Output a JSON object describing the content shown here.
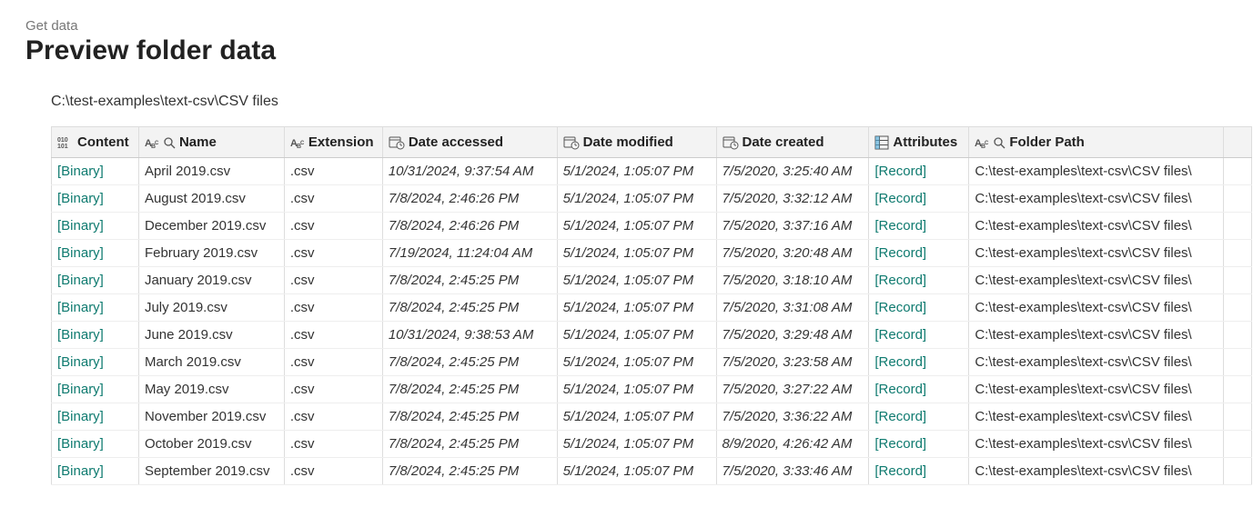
{
  "breadcrumb": "Get data",
  "title": "Preview folder data",
  "folderPath": "C:\\test-examples\\text-csv\\CSV files",
  "columns": {
    "content": "Content",
    "name": "Name",
    "extension": "Extension",
    "accessed": "Date accessed",
    "modified": "Date modified",
    "created": "Date created",
    "attributes": "Attributes",
    "folderPath": "Folder Path"
  },
  "labels": {
    "binary": "[Binary]",
    "record": "[Record]"
  },
  "rows": [
    {
      "name": "April 2019.csv",
      "ext": ".csv",
      "accessed": "10/31/2024, 9:37:54 AM",
      "modified": "5/1/2024, 1:05:07 PM",
      "created": "7/5/2020, 3:25:40 AM",
      "path": "C:\\test-examples\\text-csv\\CSV files\\"
    },
    {
      "name": "August 2019.csv",
      "ext": ".csv",
      "accessed": "7/8/2024, 2:46:26 PM",
      "modified": "5/1/2024, 1:05:07 PM",
      "created": "7/5/2020, 3:32:12 AM",
      "path": "C:\\test-examples\\text-csv\\CSV files\\"
    },
    {
      "name": "December 2019.csv",
      "ext": ".csv",
      "accessed": "7/8/2024, 2:46:26 PM",
      "modified": "5/1/2024, 1:05:07 PM",
      "created": "7/5/2020, 3:37:16 AM",
      "path": "C:\\test-examples\\text-csv\\CSV files\\"
    },
    {
      "name": "February 2019.csv",
      "ext": ".csv",
      "accessed": "7/19/2024, 11:24:04 AM",
      "modified": "5/1/2024, 1:05:07 PM",
      "created": "7/5/2020, 3:20:48 AM",
      "path": "C:\\test-examples\\text-csv\\CSV files\\"
    },
    {
      "name": "January 2019.csv",
      "ext": ".csv",
      "accessed": "7/8/2024, 2:45:25 PM",
      "modified": "5/1/2024, 1:05:07 PM",
      "created": "7/5/2020, 3:18:10 AM",
      "path": "C:\\test-examples\\text-csv\\CSV files\\"
    },
    {
      "name": "July 2019.csv",
      "ext": ".csv",
      "accessed": "7/8/2024, 2:45:25 PM",
      "modified": "5/1/2024, 1:05:07 PM",
      "created": "7/5/2020, 3:31:08 AM",
      "path": "C:\\test-examples\\text-csv\\CSV files\\"
    },
    {
      "name": "June 2019.csv",
      "ext": ".csv",
      "accessed": "10/31/2024, 9:38:53 AM",
      "modified": "5/1/2024, 1:05:07 PM",
      "created": "7/5/2020, 3:29:48 AM",
      "path": "C:\\test-examples\\text-csv\\CSV files\\"
    },
    {
      "name": "March 2019.csv",
      "ext": ".csv",
      "accessed": "7/8/2024, 2:45:25 PM",
      "modified": "5/1/2024, 1:05:07 PM",
      "created": "7/5/2020, 3:23:58 AM",
      "path": "C:\\test-examples\\text-csv\\CSV files\\"
    },
    {
      "name": "May 2019.csv",
      "ext": ".csv",
      "accessed": "7/8/2024, 2:45:25 PM",
      "modified": "5/1/2024, 1:05:07 PM",
      "created": "7/5/2020, 3:27:22 AM",
      "path": "C:\\test-examples\\text-csv\\CSV files\\"
    },
    {
      "name": "November 2019.csv",
      "ext": ".csv",
      "accessed": "7/8/2024, 2:45:25 PM",
      "modified": "5/1/2024, 1:05:07 PM",
      "created": "7/5/2020, 3:36:22 AM",
      "path": "C:\\test-examples\\text-csv\\CSV files\\"
    },
    {
      "name": "October 2019.csv",
      "ext": ".csv",
      "accessed": "7/8/2024, 2:45:25 PM",
      "modified": "5/1/2024, 1:05:07 PM",
      "created": "8/9/2020, 4:26:42 AM",
      "path": "C:\\test-examples\\text-csv\\CSV files\\"
    },
    {
      "name": "September 2019.csv",
      "ext": ".csv",
      "accessed": "7/8/2024, 2:45:25 PM",
      "modified": "5/1/2024, 1:05:07 PM",
      "created": "7/5/2020, 3:33:46 AM",
      "path": "C:\\test-examples\\text-csv\\CSV files\\"
    }
  ]
}
